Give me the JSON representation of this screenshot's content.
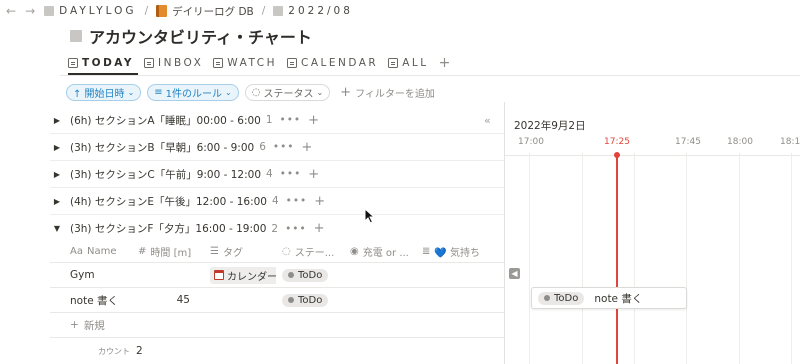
{
  "breadcrumb": {
    "workspace": "DAYLYLOG",
    "database": "デイリーログ DB",
    "page": "2022/08"
  },
  "page_title": "アカウンタビリティ・チャート",
  "tabs": [
    {
      "label": "TODAY",
      "active": true
    },
    {
      "label": "INBOX",
      "active": false
    },
    {
      "label": "WATCH",
      "active": false
    },
    {
      "label": "CALENDAR",
      "active": false
    },
    {
      "label": "ALL",
      "active": false
    }
  ],
  "filters": {
    "sort_label": "↑ 開始日時",
    "rule_label": "1件のルール",
    "status_label": "ステータス",
    "add_filter_label": "フィルターを追加"
  },
  "groups": [
    {
      "label": "(6h) セクションA「睡眠」00:00 - 6:00",
      "count": "1"
    },
    {
      "label": "(3h) セクションB「早朝」6:00 - 9:00",
      "count": "6"
    },
    {
      "label": "(3h) セクションC「午前」9:00 - 12:00",
      "count": "4"
    },
    {
      "label": "(4h) セクションE「午後」12:00 - 16:00",
      "count": "4"
    },
    {
      "label": "(3h) セクションF「夕方」16:00 - 19:00",
      "count": "2"
    }
  ],
  "table": {
    "columns": [
      "Name",
      "時間 [m]",
      "タグ",
      "ステー...",
      "充電 or ...",
      "💙 気持ち"
    ],
    "rows": [
      {
        "name": "Gym",
        "minutes": "",
        "tag": "カレンダー",
        "status": "ToDo"
      },
      {
        "name": "note 書く",
        "minutes": "45",
        "tag": "",
        "status": "ToDo"
      }
    ],
    "new_label": "新規",
    "count_label": "カウント",
    "count_value": "2"
  },
  "timeline": {
    "date": "2022年9月2日",
    "times": [
      "17:00",
      "17:25",
      "17:45",
      "18:00",
      "18:15"
    ],
    "card_status": "ToDo",
    "card_title": "note 書く"
  },
  "colors": {
    "accent": "#2383c4",
    "now_line": "#e0443a",
    "book_icon": "#e38b2c"
  }
}
